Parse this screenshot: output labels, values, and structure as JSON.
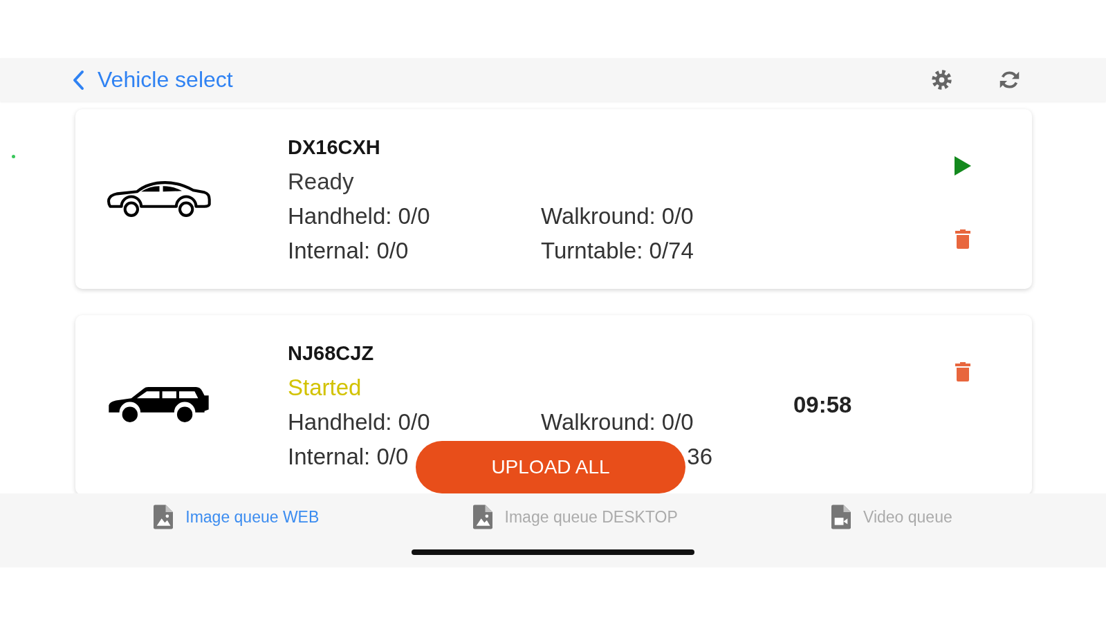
{
  "header": {
    "back_label": "Vehicle select"
  },
  "vehicles": [
    {
      "kind": "sedan",
      "registration": "DX16CXH",
      "status": "Ready",
      "started": false,
      "stats": [
        {
          "kind": "full",
          "text": "Handheld: 0/0"
        },
        {
          "kind": "full",
          "text": "Walkround: 0/0"
        },
        {
          "kind": "full",
          "text": "Internal: 0/0"
        },
        {
          "kind": "full",
          "text": "Turntable: 0/74"
        }
      ]
    },
    {
      "kind": "suv",
      "registration": "NJ68CJZ",
      "status": "Started",
      "started": true,
      "timer": "09:58",
      "stats": [
        {
          "kind": "full",
          "text": "Handheld: 0/0"
        },
        {
          "kind": "full",
          "text": "Walkround: 0/0"
        },
        {
          "kind": "full",
          "text": "Internal: 0/0"
        },
        {
          "kind": "covered",
          "text": "36"
        }
      ]
    }
  ],
  "upload_button": {
    "label": "UPLOAD ALL"
  },
  "bottom_tabs": [
    {
      "kind": "image",
      "label": "Image queue WEB",
      "selected": true
    },
    {
      "kind": "image",
      "label": "Image queue DESKTOP",
      "selected": false
    },
    {
      "kind": "video",
      "label": "Video queue",
      "selected": false
    }
  ]
}
